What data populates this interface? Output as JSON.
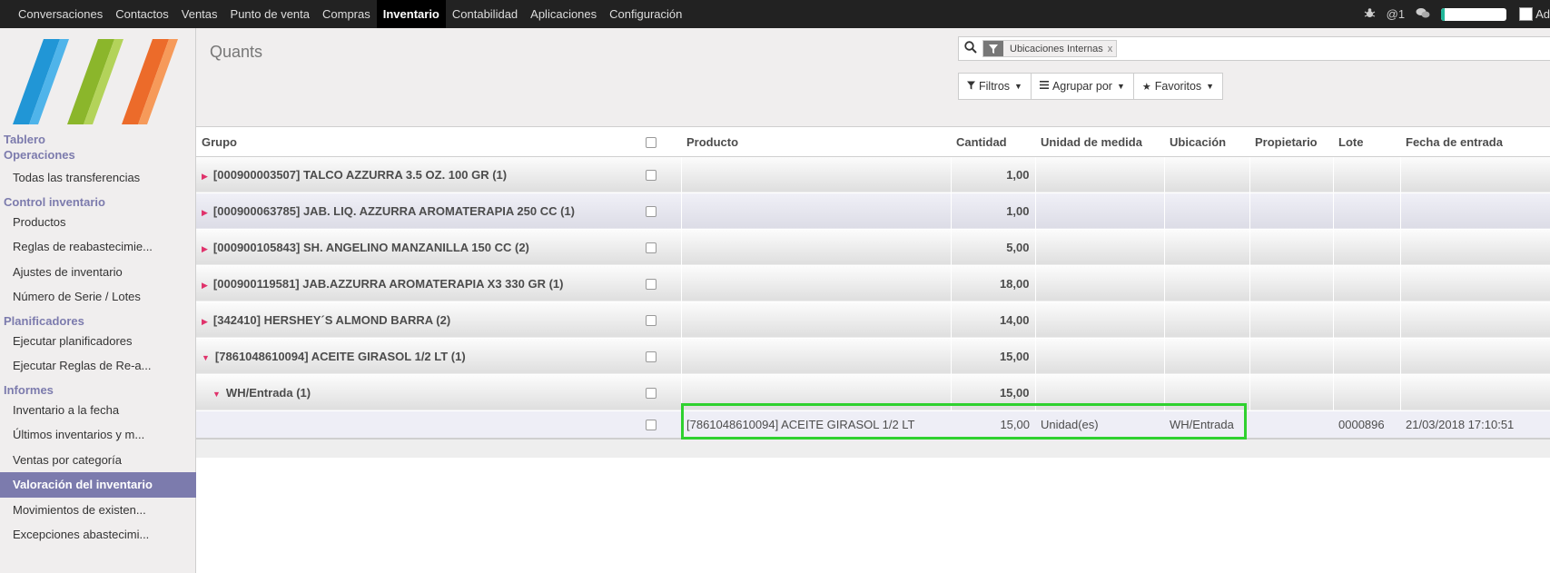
{
  "topbar": {
    "menu": [
      "Conversaciones",
      "Contactos",
      "Ventas",
      "Punto de venta",
      "Compras",
      "Inventario",
      "Contabilidad",
      "Aplicaciones",
      "Configuración"
    ],
    "active_index": 5,
    "mentions": "@1",
    "user_name": "Ad",
    "progress_fraction": 0.06
  },
  "sidebar": {
    "sections": [
      {
        "title": "Tablero",
        "items": []
      },
      {
        "title": "Operaciones",
        "items": [
          "Todas las transferencias"
        ]
      },
      {
        "title": "Control inventario",
        "items": [
          "Productos",
          "Reglas de reabastecimie...",
          "Ajustes de inventario",
          "Número de Serie / Lotes"
        ]
      },
      {
        "title": "Planificadores",
        "items": [
          "Ejecutar planificadores",
          "Ejecutar Reglas de Re-a..."
        ]
      },
      {
        "title": "Informes",
        "items": [
          "Inventario a la fecha",
          "Últimos inventarios y m...",
          "Ventas por categoría",
          "Valoración del inventario",
          "Movimientos de existen...",
          "Excepciones abastecimi..."
        ]
      }
    ],
    "active_item": "Valoración del inventario"
  },
  "control": {
    "title": "Quants",
    "facet": "Ubicaciones Internas",
    "facet_remove": "x",
    "buttons": {
      "filters": "Filtros",
      "group_by": "Agrupar por",
      "favorites": "Favoritos"
    }
  },
  "table": {
    "headers": {
      "group": "Grupo",
      "product": "Producto",
      "qty": "Cantidad",
      "uom": "Unidad de medida",
      "location": "Ubicación",
      "owner": "Propietario",
      "lot": "Lote",
      "date": "Fecha de entrada"
    },
    "groups": [
      {
        "label": "[000900003507] TALCO AZZURRA 3.5 OZ. 100 GR (1)",
        "qty": "1,00"
      },
      {
        "label": "[000900063785] JAB. LIQ. AZZURRA AROMATERAPIA 250 CC (1)",
        "qty": "1,00"
      },
      {
        "label": "[000900105843] SH. ANGELINO MANZANILLA 150 CC (2)",
        "qty": "5,00"
      },
      {
        "label": "[000900119581] JAB.AZZURRA AROMATERAPIA X3 330 GR (1)",
        "qty": "18,00"
      },
      {
        "label": "[342410] HERSHEY´S ALMOND BARRA (2)",
        "qty": "14,00"
      },
      {
        "label": "[7861048610094] ACEITE GIRASOL 1/2 LT (1)",
        "qty": "15,00"
      }
    ],
    "subgroup": {
      "label": "WH/Entrada (1)",
      "qty": "15,00"
    },
    "record": {
      "product": "[7861048610094] ACEITE GIRASOL 1/2 LT",
      "qty": "15,00",
      "uom": "Unidad(es)",
      "location": "WH/Entrada",
      "owner": "",
      "lot": "0000896",
      "date": "21/03/2018 17:10:51"
    }
  },
  "colors": {
    "accent": "#7c7bad",
    "highlight": "#2fd12f",
    "group_arrow": "#e0326b"
  }
}
